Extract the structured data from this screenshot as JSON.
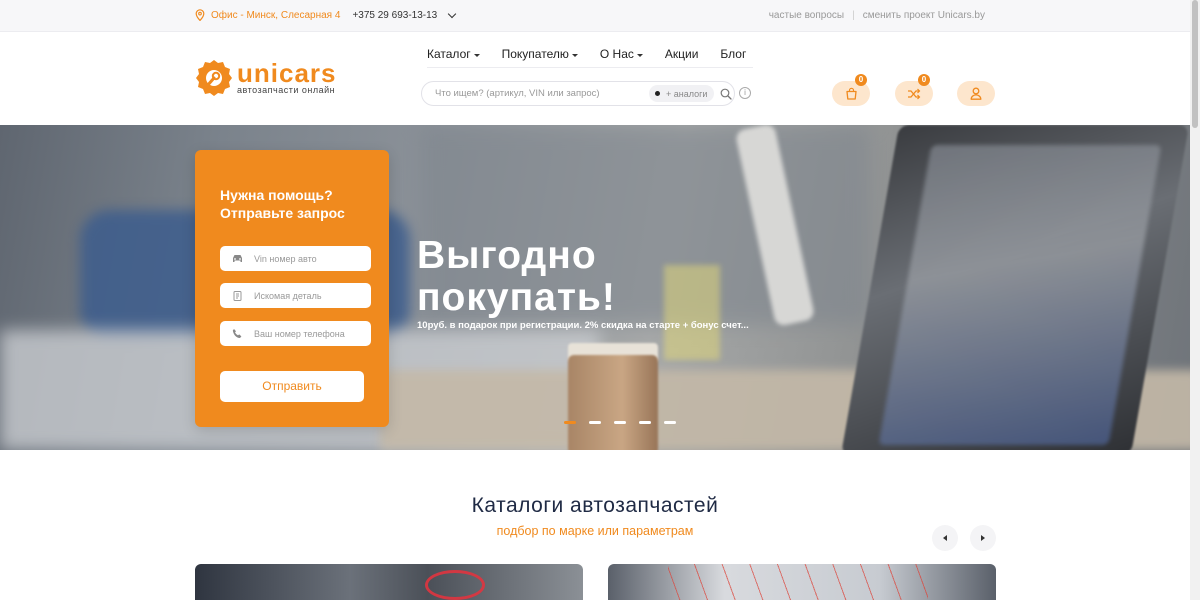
{
  "topbar": {
    "office": "Офис - Минск, Слесарная 4",
    "phone": "+375 29 693-13-13",
    "faq_link": "частые вопросы",
    "divider": "|",
    "switch_link": "сменить проект Unicars.by"
  },
  "logo": {
    "name": "unicars",
    "tagline": "автозапчасти онлайн"
  },
  "nav": {
    "items": [
      {
        "label": "Каталог",
        "dropdown": true
      },
      {
        "label": "Покупателю",
        "dropdown": true
      },
      {
        "label": "О Нас",
        "dropdown": true
      },
      {
        "label": "Акции",
        "dropdown": false
      },
      {
        "label": "Блог",
        "dropdown": false
      }
    ]
  },
  "search": {
    "placeholder": "Что ищем? (артикул, VIN или запрос)",
    "analog_label": "+ аналоги",
    "info_symbol": "i"
  },
  "header_buttons": {
    "cart_count": "0",
    "compare_count": "0"
  },
  "hero": {
    "title": "Выгодно покупать!",
    "subtitle": "10руб. в подарок при регистрации. 2% скидка на старте + бонус счет...",
    "slides_total": 5,
    "active_slide": 1
  },
  "help_form": {
    "title": "Нужна помощь? Отправьте запрос",
    "vin_placeholder": "Vin номер авто",
    "part_placeholder": "Искомая деталь",
    "phone_placeholder": "Ваш номер телефона",
    "submit_label": "Отправить"
  },
  "catalogs": {
    "title": "Каталоги автозапчастей",
    "subtitle": "подбор по марке или параметрам"
  },
  "colors": {
    "accent": "#f08a1e",
    "accent_light": "#fde6cd",
    "heading": "#1f2a44"
  }
}
